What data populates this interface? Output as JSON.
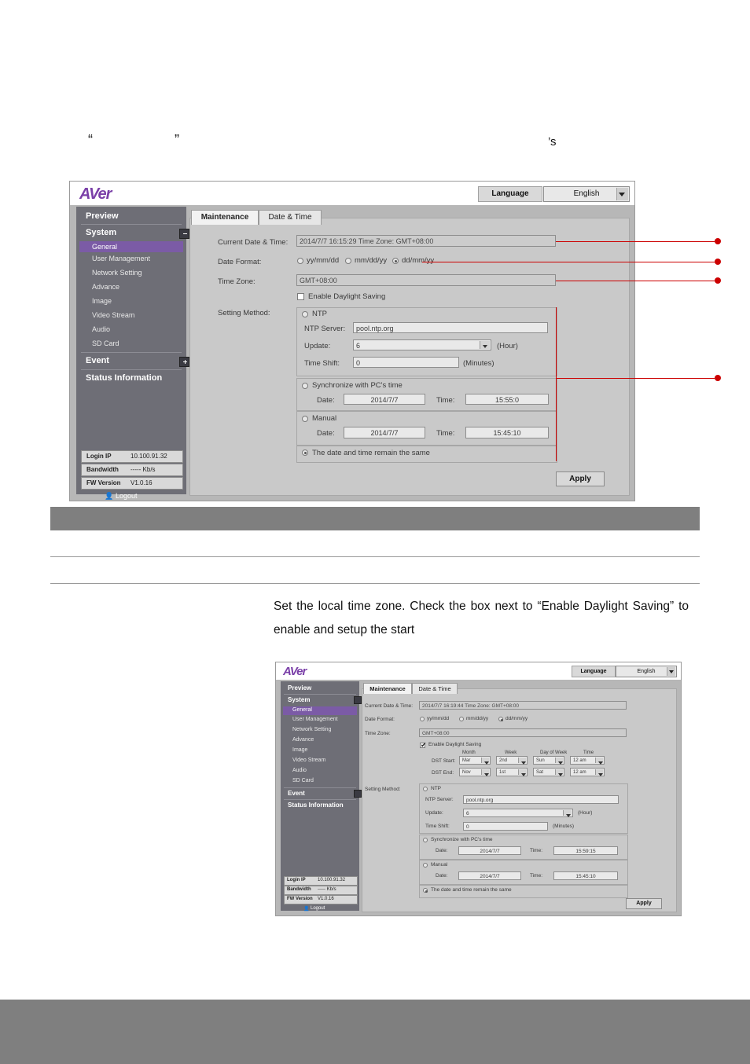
{
  "document": {
    "quote_open": "“",
    "quote_close": "”",
    "apostrophe_s": "’s",
    "paragraph": "Set the local time zone. Check the box next to “Enable Daylight Saving” to enable and setup the start"
  },
  "ui": {
    "brand": "AVer",
    "language_label": "Language",
    "language_value": "English",
    "tabs": [
      {
        "label": "Maintenance",
        "active": true
      },
      {
        "label": "Date & Time",
        "active": false
      }
    ],
    "sidebar": [
      {
        "label": "Preview",
        "type": "head"
      },
      {
        "label": "System",
        "type": "head",
        "expander": "minus"
      },
      {
        "label": "General",
        "type": "sub",
        "selected": true
      },
      {
        "label": "User Management",
        "type": "sub"
      },
      {
        "label": "Network Setting",
        "type": "sub"
      },
      {
        "label": "Advance",
        "type": "sub"
      },
      {
        "label": "Image",
        "type": "sub"
      },
      {
        "label": "Video Stream",
        "type": "sub"
      },
      {
        "label": "Audio",
        "type": "sub"
      },
      {
        "label": "SD Card",
        "type": "sub"
      },
      {
        "label": "Event",
        "type": "head",
        "expander": "plus"
      },
      {
        "label": "Status Information",
        "type": "head"
      }
    ],
    "status": {
      "login_ip_label": "Login IP",
      "login_ip_value": "10.100.91.32",
      "bandwidth_label": "Bandwidth",
      "bandwidth_value": "----- Kb/s",
      "fw_label": "FW Version",
      "fw_value": "V1.0.16",
      "logout": "Logout"
    },
    "form": {
      "current_datetime_label": "Current Date & Time:",
      "current_datetime_value": "2014/7/7 16:15:29 Time Zone: GMT+08:00",
      "date_format_label": "Date Format:",
      "date_formats": [
        "yy/mm/dd",
        "mm/dd/yy",
        "dd/mm/yy"
      ],
      "date_format_selected": "dd/mm/yy",
      "time_zone_label": "Time Zone:",
      "time_zone_value": "GMT+08:00",
      "dst_label": "Enable Daylight Saving",
      "dst_checked": false,
      "setting_method_label": "Setting Method:",
      "ntp_label": "NTP",
      "ntp_server_label": "NTP Server:",
      "ntp_server_value": "pool.ntp.org",
      "update_label": "Update:",
      "update_value": "6",
      "update_unit": "(Hour)",
      "time_shift_label": "Time Shift:",
      "time_shift_value": "0",
      "time_shift_unit": "(Minutes)",
      "sync_pc_label": "Synchronize with PC's time",
      "sync_date_label": "Date:",
      "sync_date_value": "2014/7/7",
      "sync_time_label": "Time:",
      "sync_time_value": "15:55:0",
      "manual_label": "Manual",
      "manual_date_label": "Date:",
      "manual_date_value": "2014/7/7",
      "manual_time_label": "Time:",
      "manual_time_value": "15:45:10",
      "remain_label": "The date and time remain the same",
      "apply_label": "Apply",
      "selected_method": "remain"
    }
  },
  "ui2": {
    "brand": "AVer",
    "language_label": "Language",
    "language_value": "English",
    "tabs": [
      {
        "label": "Maintenance",
        "active": true
      },
      {
        "label": "Date & Time",
        "active": false
      }
    ],
    "sidebar": [
      {
        "label": "Preview",
        "type": "head"
      },
      {
        "label": "System",
        "type": "head",
        "expander": "minus"
      },
      {
        "label": "General",
        "type": "sub",
        "selected": true
      },
      {
        "label": "User Management",
        "type": "sub"
      },
      {
        "label": "Network Setting",
        "type": "sub"
      },
      {
        "label": "Advance",
        "type": "sub"
      },
      {
        "label": "Image",
        "type": "sub"
      },
      {
        "label": "Video Stream",
        "type": "sub"
      },
      {
        "label": "Audio",
        "type": "sub"
      },
      {
        "label": "SD Card",
        "type": "sub"
      },
      {
        "label": "Event",
        "type": "head",
        "expander": "plus"
      },
      {
        "label": "Status Information",
        "type": "head"
      }
    ],
    "status": {
      "login_ip_label": "Login IP",
      "login_ip_value": "10.100.91.32",
      "bandwidth_label": "Bandwidth",
      "bandwidth_value": "----- Kb/s",
      "fw_label": "FW Version",
      "fw_value": "V1.0.16",
      "logout": "Logout"
    },
    "form": {
      "current_datetime_label": "Current Date & Time:",
      "current_datetime_value": "2014/7/7 16:19:44 Time Zone: GMT+08:00",
      "date_format_label": "Date Format:",
      "date_formats": [
        "yy/mm/dd",
        "mm/dd/yy",
        "dd/mm/yy"
      ],
      "date_format_selected": "dd/mm/yy",
      "time_zone_label": "Time Zone:",
      "time_zone_value": "GMT+08:00",
      "dst_label": "Enable Daylight Saving",
      "dst_checked": true,
      "dst_columns": [
        "Month",
        "Week",
        "Day of Week",
        "Time"
      ],
      "dst_start_label": "DST Start:",
      "dst_start": [
        "Mar",
        "2nd",
        "Sun",
        "12 am"
      ],
      "dst_end_label": "DST End:",
      "dst_end": [
        "Nov",
        "1st",
        "Sat",
        "12 am"
      ],
      "setting_method_label": "Setting Method:",
      "ntp_label": "NTP",
      "ntp_server_label": "NTP Server:",
      "ntp_server_value": "pool.ntp.org",
      "update_label": "Update:",
      "update_value": "6",
      "update_unit": "(Hour)",
      "time_shift_label": "Time Shift:",
      "time_shift_value": "0",
      "time_shift_unit": "(Minutes)",
      "sync_pc_label": "Synchronize with PC's time",
      "sync_date_label": "Date:",
      "sync_date_value": "2014/7/7",
      "sync_time_label": "Time:",
      "sync_time_value": "15:59:15",
      "manual_label": "Manual",
      "manual_date_label": "Date:",
      "manual_date_value": "2014/7/7",
      "manual_time_label": "Time:",
      "manual_time_value": "15:45:10",
      "remain_label": "The date and time remain the same",
      "apply_label": "Apply",
      "selected_method": "remain"
    }
  }
}
